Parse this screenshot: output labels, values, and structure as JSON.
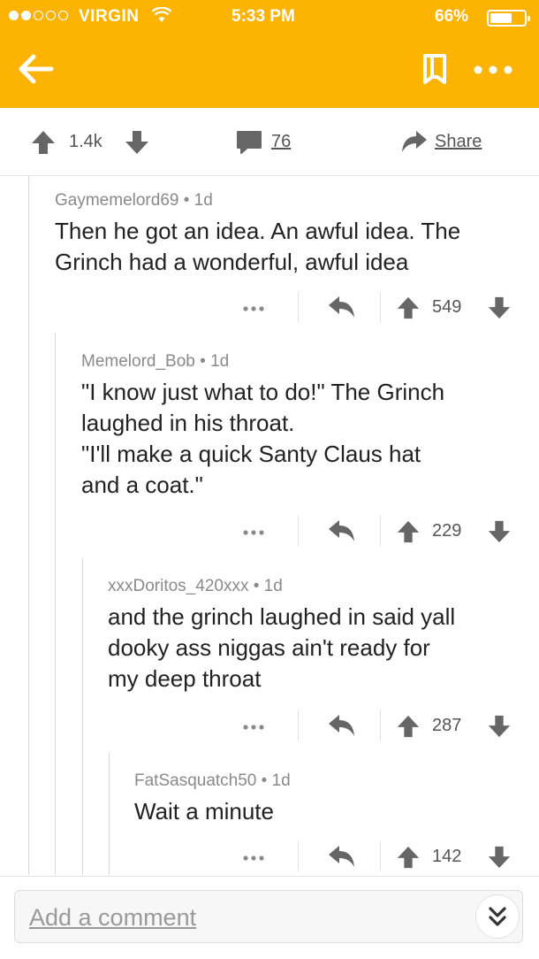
{
  "status_bar": {
    "carrier": "VIRGIN",
    "time": "5:33 PM",
    "battery": "66%",
    "battery_level": 0.66,
    "signal_bars_filled": 2,
    "signal_bars_total": 5
  },
  "colors": {
    "header_bg": "#fdb302",
    "text_primary": "#222222",
    "text_meta": "#8a8a8a",
    "icon_gray": "#666666"
  },
  "post_actions": {
    "score": "1.4k",
    "comment_count": "76",
    "share_label": "Share"
  },
  "comments": [
    {
      "author": "Gaymemelord69",
      "age": "1d",
      "body": "Then he got an idea. An awful idea. The\nGrinch had a wonderful, awful idea",
      "score": "549"
    },
    {
      "author": "Memelord_Bob",
      "age": "1d",
      "body": "\"I know just what to do!\" The Grinch\nlaughed in his throat.\n\"I'll make a quick Santy Claus hat\nand a coat.\"",
      "score": "229"
    },
    {
      "author": "xxxDoritos_420xxx",
      "age": "1d",
      "body": "and the grinch laughed in said yall\ndooky ass niggas ain't ready for\nmy deep throat",
      "score": "287"
    },
    {
      "author": "FatSasquatch50",
      "age": "1d",
      "body": "Wait a minute",
      "score": "142"
    }
  ],
  "comment_input": {
    "placeholder": "Add a comment"
  },
  "icons": {
    "back": "back-arrow-icon",
    "bookmark": "bookmark-icon",
    "more": "more-horizontal-icon",
    "upvote": "upvote-arrow-icon",
    "downvote": "downvote-arrow-icon",
    "comments": "comment-bubble-icon",
    "share": "share-arrow-icon",
    "reply": "reply-arrow-icon",
    "expand": "double-chevron-down-icon"
  }
}
